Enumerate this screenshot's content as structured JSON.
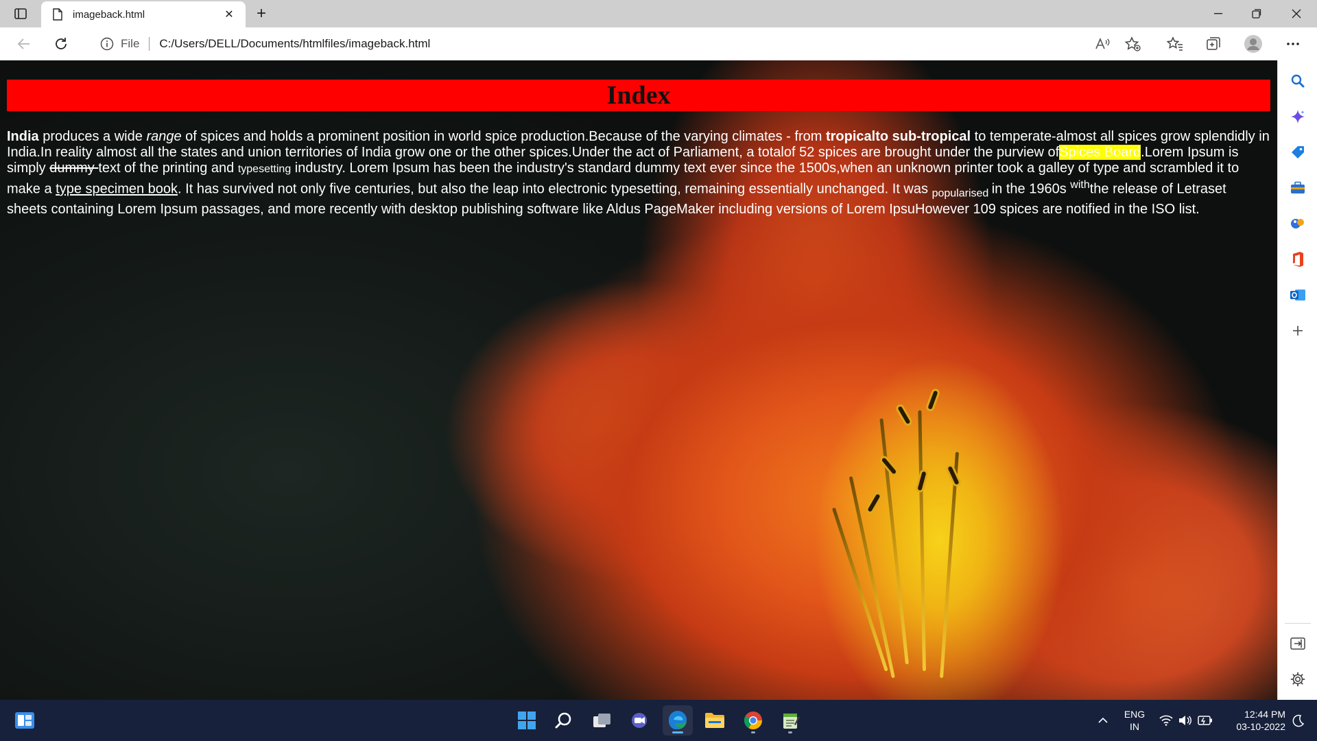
{
  "browser": {
    "tab_title": "imageback.html",
    "address_scheme": "File",
    "address_url": "C:/Users/DELL/Documents/htmlfiles/imageback.html"
  },
  "page": {
    "heading": "Index",
    "para": {
      "india": "India",
      "t1": " produces a wide ",
      "range": "range",
      "t2": " of spices and holds a prominent position in world spice production.Because of the varying climates - from ",
      "tropical": "tropicalto sub-tropical",
      "t3": " to temperate-almost all spices grow splendidly in India.In reality almost all the states and union territories of India grow one or the other spices.Under the act of Parliament, a totalof 52 spices are brought under the purview of",
      "spices_board": "Spices Board",
      "t4": ".Lorem Ipsum is simply ",
      "dummy": "dummy ",
      "t5": "text of the printing and ",
      "typesetting": "typesetting",
      "t6": " industry. Lorem Ipsum has been the industry's standard dummy text ever since the 1500s,when an unknown printer took a galley of type and scrambled it to make a ",
      "specimen": "type specimen book",
      "t7": ". It has survived not only five centuries, but also the leap into electronic typesetting, remaining essentially unchanged. It was ",
      "popularised": "popularised ",
      "t8": "in the 1960s ",
      "with": "with",
      "t9": "the release of Letraset sheets containing Lorem Ipsum passages, and more recently with desktop publishing software like Aldus PageMaker including versions of Lorem IpsuHowever 109 spices are notified in the ISO list."
    }
  },
  "taskbar": {
    "lang_top": "ENG",
    "lang_bottom": "IN",
    "time": "12:44 PM",
    "date": "03-10-2022"
  }
}
